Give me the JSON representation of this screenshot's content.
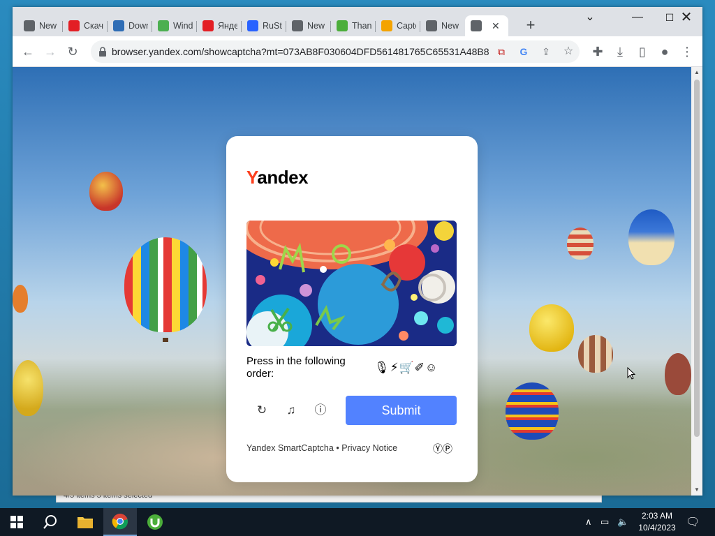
{
  "desktop": {
    "background_window_text": "4/5 items    5 items selected"
  },
  "browser": {
    "tabs": [
      {
        "title": "New",
        "icon": "chrome-icon",
        "color": "#5f6368"
      },
      {
        "title": "Скачать",
        "icon": "yandex-disk-icon",
        "color": "#e31e24"
      },
      {
        "title": "Download",
        "icon": "download-site-icon",
        "color": "#2f6db5"
      },
      {
        "title": "Windows",
        "icon": "windows-site-icon",
        "color": "#4caf50"
      },
      {
        "title": "Яндекс",
        "icon": "yandex-icon",
        "color": "#e31e24"
      },
      {
        "title": "RuStore",
        "icon": "rustore-icon",
        "color": "#2962ff"
      },
      {
        "title": "New",
        "icon": "chrome-icon",
        "color": "#5f6368"
      },
      {
        "title": "Thank",
        "icon": "utorrent-icon",
        "color": "#4cae3b"
      },
      {
        "title": "Captcha",
        "icon": "captcha-icon",
        "color": "#f4a300"
      },
      {
        "title": "New",
        "icon": "chrome-icon",
        "color": "#5f6368"
      },
      {
        "title": "",
        "icon": "globe-icon",
        "color": "#5f6368",
        "active": true
      }
    ],
    "new_tab_label": "+",
    "url": "browser.yandex.com/showcaptcha?mt=073AB8F030604DFD561481765C65531A48B8..."
  },
  "captcha": {
    "brand": {
      "first": "Y",
      "rest": "andex"
    },
    "instruction": "Press in the following order:",
    "order_symbols": "🎙⚡🛒✐☺",
    "submit_label": "Submit",
    "footer_brand": "Yandex SmartCaptcha",
    "footer_sep": "•",
    "footer_privacy": "Privacy Notice",
    "footer_logo": "ⓎⓅ"
  },
  "taskbar": {
    "time": "2:03 AM",
    "date": "10/4/2023"
  },
  "colors": {
    "submit": "#5282ff",
    "yandex_red": "#fc3f1d",
    "taskbar": "#0f1924"
  }
}
